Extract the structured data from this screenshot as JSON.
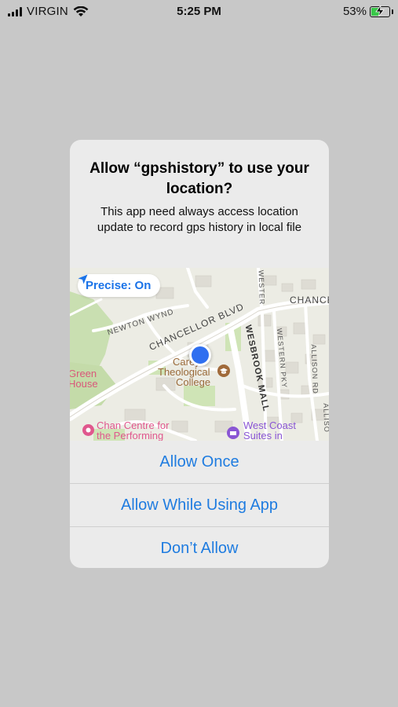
{
  "status_bar": {
    "carrier": "VIRGIN",
    "time": "5:25 PM",
    "battery_percent": "53%",
    "battery_level": 0.53,
    "charging": true,
    "battery_color": "#3ac84a"
  },
  "alert": {
    "title": "Allow “gpshistory” to use your location?",
    "message": "This app need always access location update to record gps history in local file",
    "precise_label": "Precise: On",
    "actions": {
      "allow_once": "Allow Once",
      "allow_while_using": "Allow While Using App",
      "dont_allow": "Don’t Allow"
    },
    "action_color": "#1f7ce0"
  },
  "map": {
    "streets": {
      "newton_wynd": "NEWTON WYND",
      "chancellor_blvd": "CHANCELLOR BLVD",
      "chancellor_right": "CHANCE",
      "wesbrook_mall": "WESBROOK MALL",
      "western_pkwy": "WESTERN PKY",
      "allison_rd": "ALLISON RD",
      "allison_edge": "ALLISO",
      "wester_top": "WESTER"
    },
    "poi": {
      "theological_college_line1": "Carey",
      "theological_college_line2": "Theological",
      "theological_college_line3": "College",
      "green_house_line1": "Green",
      "green_house_line2": "House",
      "chan_centre_line1": "Chan Centre for",
      "chan_centre_line2": "the Performing",
      "west_coast_line1": "West Coast",
      "west_coast_line2": "Suites in"
    }
  }
}
